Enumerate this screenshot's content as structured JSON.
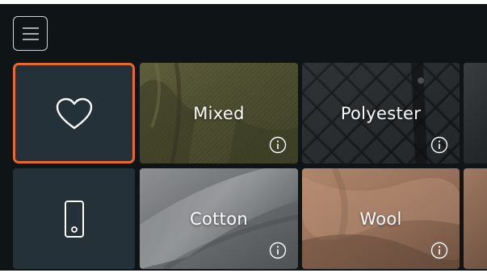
{
  "header": {
    "menu_icon": "hamburger-menu-icon"
  },
  "grid": {
    "row1": [
      {
        "type": "icon",
        "icon": "heart-icon",
        "focused": true
      },
      {
        "type": "category",
        "label": "Mixed",
        "info_icon": "info-icon"
      },
      {
        "type": "category",
        "label": "Polyester",
        "info_icon": "info-icon"
      },
      {
        "type": "partial"
      }
    ],
    "row2": [
      {
        "type": "icon",
        "icon": "phone-icon",
        "focused": false
      },
      {
        "type": "category",
        "label": "Cotton",
        "info_icon": "info-icon"
      },
      {
        "type": "category",
        "label": "Wool",
        "info_icon": "info-icon"
      },
      {
        "type": "partial"
      }
    ]
  },
  "colors": {
    "background": "#0f1417",
    "tile_dark": "#253138",
    "focus_ring": "#e8692d"
  }
}
